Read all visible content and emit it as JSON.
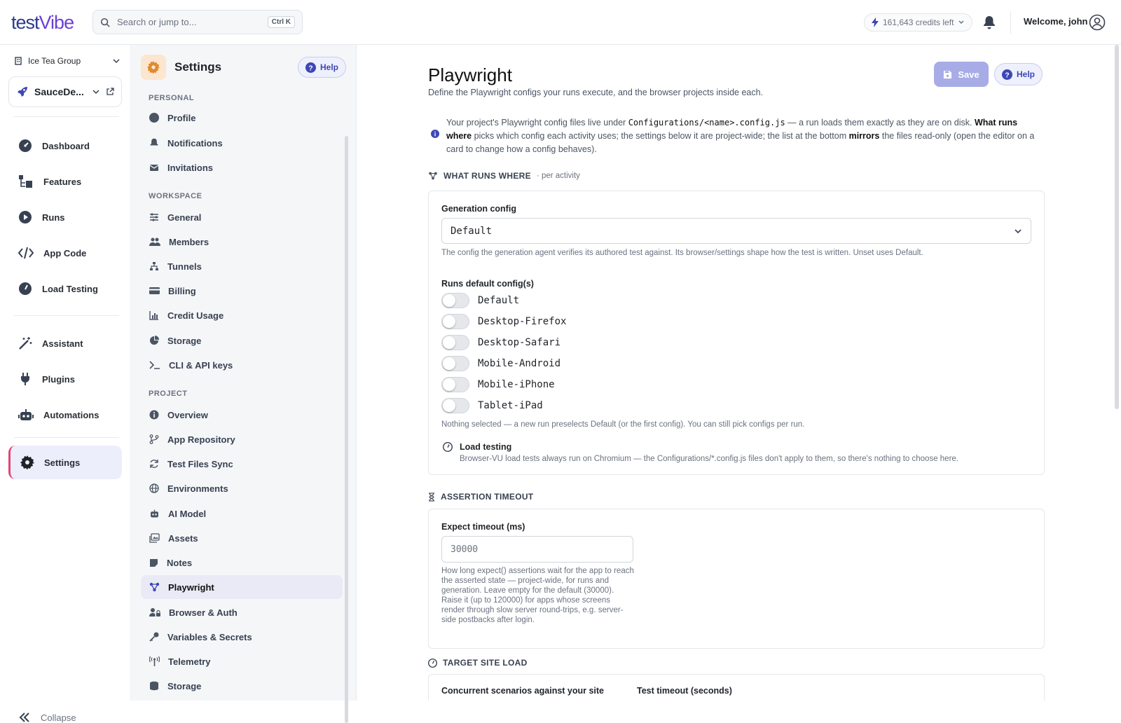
{
  "header": {
    "logo": {
      "part1": "test",
      "part2": "Vibe"
    },
    "search": {
      "placeholder": "Search or jump to...",
      "shortcut": "Ctrl K"
    },
    "credits": "161,643 credits left",
    "welcome": "Welcome, john"
  },
  "sidebar": {
    "org": "Ice Tea Group",
    "project": "SauceDe...",
    "items": [
      {
        "label": "Dashboard",
        "icon": "gauge-icon"
      },
      {
        "label": "Features",
        "icon": "features-icon"
      },
      {
        "label": "Runs",
        "icon": "play-circle-icon"
      },
      {
        "label": "App Code",
        "icon": "code-icon"
      },
      {
        "label": "Load Testing",
        "icon": "speedometer-icon"
      },
      {
        "label": "Assistant",
        "icon": "magic-wand-icon"
      },
      {
        "label": "Plugins",
        "icon": "plug-icon"
      },
      {
        "label": "Automations",
        "icon": "robot-icon"
      },
      {
        "label": "Settings",
        "icon": "gear-icon"
      }
    ],
    "collapse": "Collapse"
  },
  "settings_nav": {
    "title": "Settings",
    "help": "Help",
    "sections": {
      "personal": "PERSONAL",
      "workspace": "WORKSPACE",
      "project": "PROJECT"
    },
    "personal": [
      "Profile",
      "Notifications",
      "Invitations"
    ],
    "workspace": [
      "General",
      "Members",
      "Tunnels",
      "Billing",
      "Credit Usage",
      "Storage",
      "CLI & API keys"
    ],
    "project": [
      "Overview",
      "App Repository",
      "Test Files Sync",
      "Environments",
      "AI Model",
      "Assets",
      "Notes",
      "Playwright",
      "Browser & Auth",
      "Variables & Secrets",
      "Telemetry",
      "Storage"
    ]
  },
  "page": {
    "title": "Playwright",
    "subtitle": "Define the Playwright configs your runs execute, and the browser projects inside each.",
    "save": "Save",
    "help": "Help",
    "info": {
      "t1": "Your project's Playwright config files live under ",
      "code": "Configurations/<name>.config.js",
      "t2": " — a run loads them exactly as they are on disk. ",
      "b1": "What runs where",
      "t3": " picks which config each activity uses; the settings below it are project-wide; the list at the bottom ",
      "b2": "mirrors",
      "t4": " the files read-only (open the editor on a card to change how a config behaves)."
    },
    "what_runs": {
      "heading": "WHAT RUNS WHERE",
      "note": "· per activity",
      "gen_label": "Generation config",
      "gen_value": "Default",
      "gen_help": "The config the generation agent verifies its authored test against. Its browser/settings shape how the test is written. Unset uses Default.",
      "runs_label": "Runs default config(s)",
      "toggles": [
        {
          "label": "Default",
          "on": false
        },
        {
          "label": "Desktop-Firefox",
          "on": false
        },
        {
          "label": "Desktop-Safari",
          "on": false
        },
        {
          "label": "Mobile-Android",
          "on": false
        },
        {
          "label": "Mobile-iPhone",
          "on": false
        },
        {
          "label": "Tablet-iPad",
          "on": false
        }
      ],
      "runs_help": "Nothing selected — a new run preselects Default (or the first config). You can still pick configs per run.",
      "load_title": "Load testing",
      "load_help": "Browser-VU load tests always run on Chromium — the Configurations/*.config.js files don't apply to them, so there's nothing to choose here."
    },
    "assertion": {
      "heading": "ASSERTION TIMEOUT",
      "label": "Expect timeout (ms)",
      "placeholder": "30000",
      "help": "How long expect() assertions wait for the app to reach the asserted state — project-wide, for runs and generation. Leave empty for the default (30000). Raise it (up to 120000) for apps whose screens render through slow server round-trips, e.g. server-side postbacks after login."
    },
    "target": {
      "heading": "TARGET SITE LOAD",
      "concurrent_label": "Concurrent scenarios against your site",
      "timeout_label": "Test timeout (seconds)"
    }
  }
}
